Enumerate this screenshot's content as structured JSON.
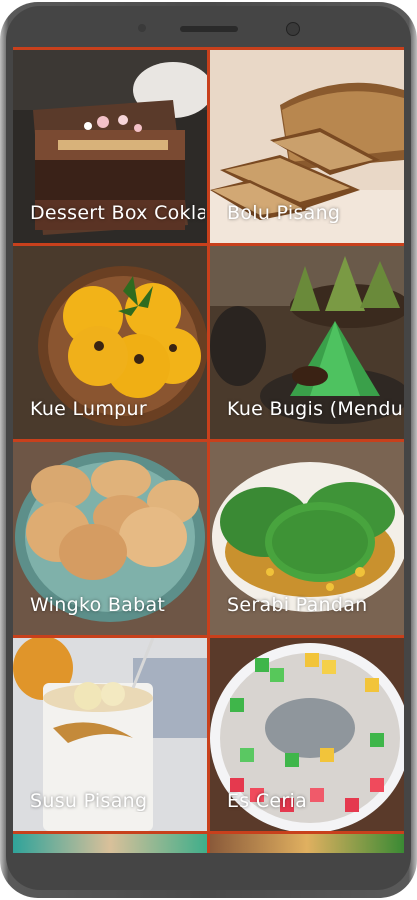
{
  "app": {
    "items": [
      {
        "label": "Dessert Box Coklat",
        "image": "dessert-box-photo"
      },
      {
        "label": "Bolu Pisang",
        "image": "banana-cake-photo"
      },
      {
        "label": "Kue Lumpur",
        "image": "kue-lumpur-photo"
      },
      {
        "label": "Kue Bugis (Mendut)",
        "image": "kue-bugis-photo"
      },
      {
        "label": "Wingko Babat",
        "image": "wingko-babat-photo"
      },
      {
        "label": "Serabi Pandan",
        "image": "serabi-pandan-photo"
      },
      {
        "label": "Susu Pisang",
        "image": "banana-milk-photo"
      },
      {
        "label": "Es Ceria",
        "image": "es-ceria-photo"
      }
    ]
  },
  "colors": {
    "grid_background": "#c8401c",
    "label_text": "#ffffff",
    "phone_body": "#454545"
  }
}
